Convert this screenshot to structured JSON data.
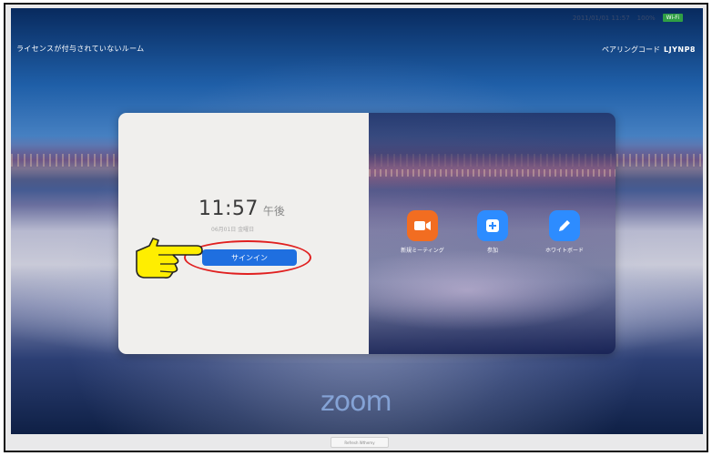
{
  "status_bar": {
    "datetime": "2011/01/01 11:57",
    "battery": "100%",
    "wifi": "Wi-Fi"
  },
  "room": {
    "license_label": "ライセンスが付与されていないルーム"
  },
  "pairing": {
    "label": "ペアリングコード",
    "code": "LJYNP8"
  },
  "clock": {
    "time": "11:57",
    "ampm": "午後",
    "date": "06月01日 金曜日"
  },
  "signin": {
    "label": "サインイン"
  },
  "actions": [
    {
      "label": "新規ミーティング",
      "icon": "video-camera-icon",
      "color": "#f26d21"
    },
    {
      "label": "参加",
      "icon": "plus-icon",
      "color": "#2d8cff"
    },
    {
      "label": "ホワイトボード",
      "icon": "pencil-icon",
      "color": "#2d8cff"
    }
  ],
  "brand": {
    "logo": "zoom"
  },
  "footer": {
    "refresh_label": "Refresh Wthemy"
  },
  "colors": {
    "signin_button": "#1f6fe0",
    "highlight_ring": "#e02020",
    "pointer_hand": "#ffee00"
  }
}
